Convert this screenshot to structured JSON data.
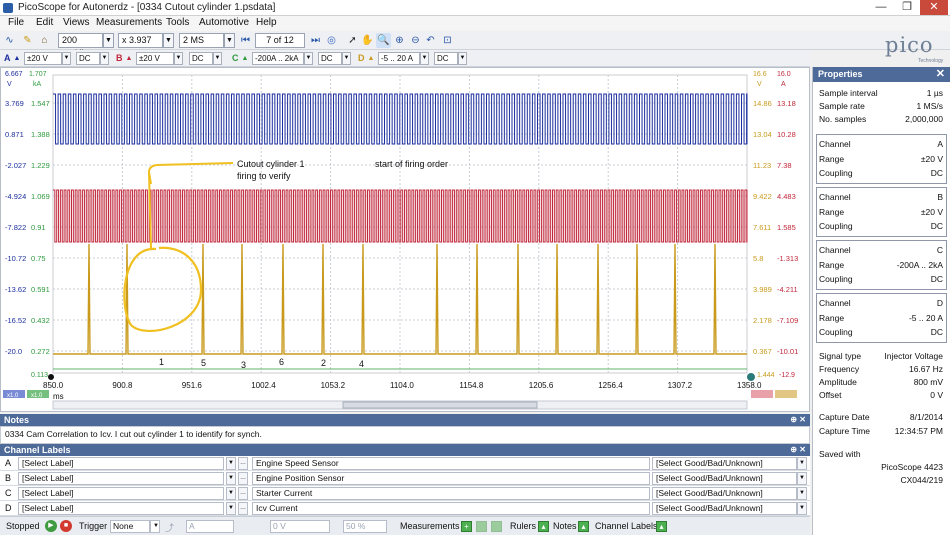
{
  "window": {
    "title": "PicoScope for Autonerdz - [0334 Cutout cylinder 1.psdata]",
    "minimize": "—",
    "maximize": "❐",
    "close": "✕"
  },
  "menu": [
    "File",
    "Edit",
    "Views",
    "Measurements",
    "Tools",
    "Automotive",
    "Help"
  ],
  "toolbar": {
    "timebase": "200 ms/div",
    "zoom": "x 3.937",
    "samples": "2 MS",
    "capture_index": "7 of 12"
  },
  "logo": {
    "text": "pico",
    "sub": "Technology"
  },
  "channels": [
    {
      "letter": "A",
      "range": "±20 V",
      "coupling": "DC",
      "color": "#1d2f9e"
    },
    {
      "letter": "B",
      "range": "±20 V",
      "coupling": "DC",
      "color": "#c0283c"
    },
    {
      "letter": "C",
      "range": "-200A .. 2kA",
      "coupling": "DC",
      "color": "#2e9a3e"
    },
    {
      "letter": "D",
      "range": "-5 .. 20 A",
      "coupling": "DC",
      "color": "#c99a1c"
    }
  ],
  "scope": {
    "left_axis_unit_a": "V",
    "left_axis_unit_c": "kA",
    "left_top_a": "6.667",
    "left_top_c": "1.707",
    "left_ticks_a": [
      "3.769",
      "0.871",
      "-2.027",
      "-4.924",
      "-7.822",
      "-10.72",
      "-13.62",
      "-16.52",
      "-20.0"
    ],
    "left_ticks_c": [
      "1.547",
      "1.388",
      "1.229",
      "1.069",
      "0.91",
      "0.75",
      "0.591",
      "0.432",
      "0.272"
    ],
    "left_bottom_c": "0.113",
    "right_top_b": "16.6",
    "right_top_d": "16.0",
    "right_axis_unit_b": "V",
    "right_axis_unit_d": "A",
    "right_ticks_b": [
      "14.86",
      "13.04",
      "11.23",
      "9.422",
      "7.611",
      "5.8",
      "3.989",
      "2.178",
      "0.367"
    ],
    "right_ticks_d": [
      "13.18",
      "10.28",
      "7.38",
      "4.483",
      "1.585",
      "-1.313",
      "-4.211",
      "-7.109",
      "-10.01"
    ],
    "right_bottom_b": "1.444",
    "right_bottom_d": "-12.9",
    "x_ticks": [
      "850.0",
      "900.8",
      "951.6",
      "1002.4",
      "1053.2",
      "1104.0",
      "1154.8",
      "1205.6",
      "1256.4",
      "1307.2",
      "1358.0"
    ],
    "x_unit": "ms",
    "annotation_cutout": "Cutout cylinder 1\nfiring to verify",
    "annotation_start": "start of firing order",
    "firing_numbers": [
      "1",
      "5",
      "3",
      "6",
      "2",
      "4"
    ],
    "ruler_a": "x1.0",
    "ruler_b": "x1.0"
  },
  "notes": {
    "header": "Notes",
    "text": "0334 Cam Correlation to Icv. I cut out cylinder 1 to identify for synch."
  },
  "channel_labels": {
    "header": "Channel Labels",
    "rows": [
      {
        "letter": "A",
        "label": "[Select Label]",
        "name": "Engine Speed Sensor",
        "quality": "[Select Good/Bad/Unknown]"
      },
      {
        "letter": "B",
        "label": "[Select Label]",
        "name": "Engine Position Sensor",
        "quality": "[Select Good/Bad/Unknown]"
      },
      {
        "letter": "C",
        "label": "[Select Label]",
        "name": "Starter Current",
        "quality": "[Select Good/Bad/Unknown]"
      },
      {
        "letter": "D",
        "label": "[Select Label]",
        "name": "Icv Current",
        "quality": "[Select Good/Bad/Unknown]"
      }
    ]
  },
  "status": {
    "state": "Stopped",
    "trigger_label": "Trigger",
    "trigger_mode": "None",
    "trigger_channel": "A",
    "trigger_level": "0 V",
    "trigger_percent": "50 %",
    "measurements": "Measurements",
    "rulers": "Rulers",
    "notes": "Notes",
    "channel_labels": "Channel Labels"
  },
  "properties": {
    "header": "Properties",
    "sample_interval_k": "Sample interval",
    "sample_interval_v": "1 µs",
    "sample_rate_k": "Sample rate",
    "sample_rate_v": "1 MS/s",
    "no_samples_k": "No. samples",
    "no_samples_v": "2,000,000",
    "channel_k": "Channel",
    "range_k": "Range",
    "coupling_k": "Coupling",
    "signal_type_k": "Signal type",
    "signal_type_v": "Injector Voltage",
    "frequency_k": "Frequency",
    "frequency_v": "16.67 Hz",
    "amplitude_k": "Amplitude",
    "amplitude_v": "800 mV",
    "offset_k": "Offset",
    "offset_v": "0 V",
    "capture_date_k": "Capture Date",
    "capture_date_v": "8/1/2014",
    "capture_time_k": "Capture Time",
    "capture_time_v": "12:34:57 PM",
    "saved_with_k": "Saved with",
    "saved_with_v1": "PicoScope 4423",
    "saved_with_v2": "CX044/219"
  }
}
